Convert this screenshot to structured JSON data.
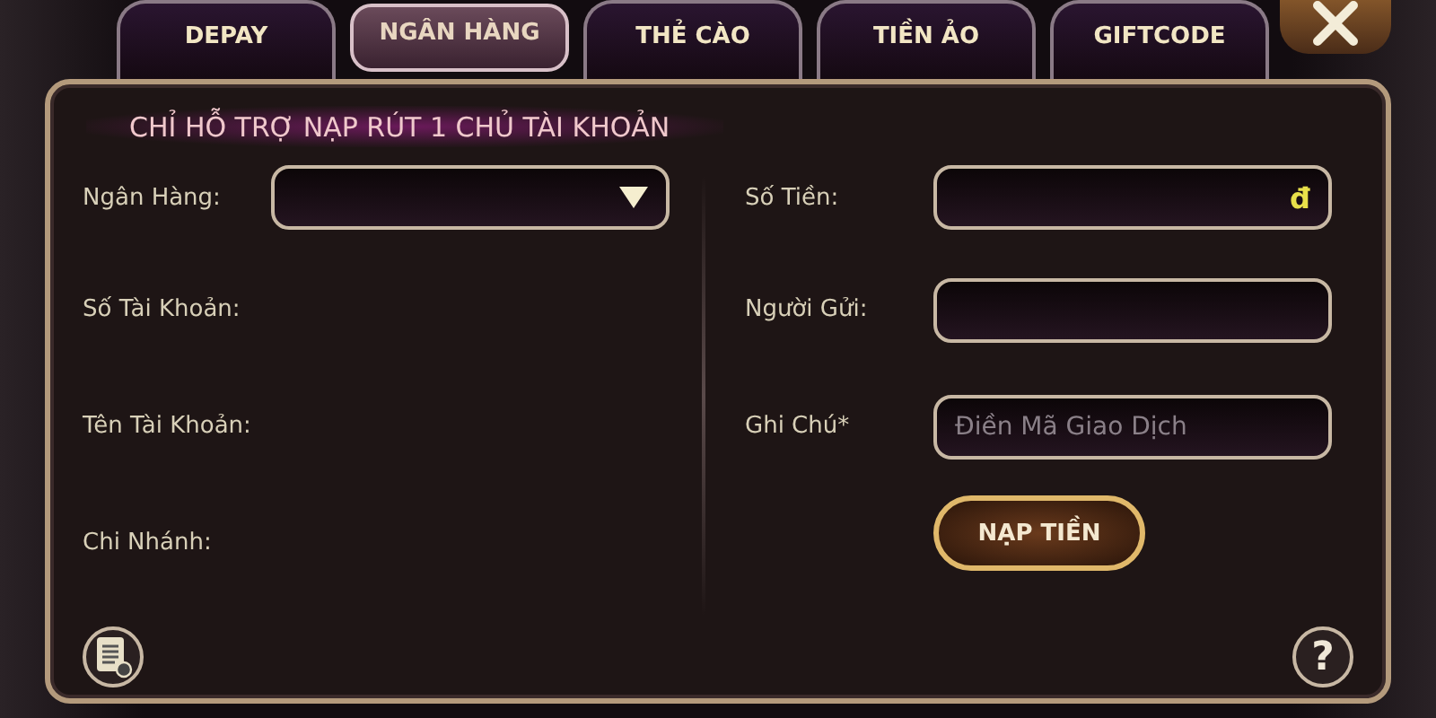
{
  "tabs": [
    {
      "label": "DEPAY",
      "selected": false
    },
    {
      "label": "NGÂN HÀNG",
      "selected": true
    },
    {
      "label": "THẺ CÀO",
      "selected": false
    },
    {
      "label": "TIỀN ẢO",
      "selected": false
    },
    {
      "label": "GIFTCODE",
      "selected": false
    }
  ],
  "notice": "CHỈ HỖ TRỢ NẠP RÚT 1 CHỦ TÀI KHOẢN",
  "left_fields": [
    {
      "label": "Ngân Hàng:",
      "kind": "dropdown"
    },
    {
      "label": "Số Tài Khoản:",
      "kind": "text"
    },
    {
      "label": "Tên Tài Khoản:",
      "kind": "text"
    },
    {
      "label": "Chi Nhánh:",
      "kind": "text"
    }
  ],
  "right_fields": [
    {
      "label": "Số Tiền:",
      "suffix": "đ"
    },
    {
      "label": "Người Gửi:"
    },
    {
      "label": "Ghi Chú*",
      "placeholder": "Điền Mã Giao Dịch"
    }
  ],
  "submit_button": "NẠP TIỀN",
  "help_button": "?"
}
